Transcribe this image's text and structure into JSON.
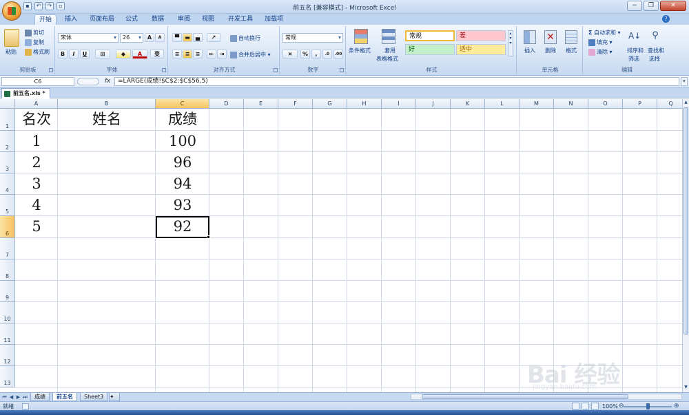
{
  "window": {
    "title": "前五名 [兼容模式] - Microsoft Excel",
    "minimize_label": "−",
    "restore_label": "❐",
    "close_label": "✕"
  },
  "ribbon_tabs": [
    "开始",
    "插入",
    "页面布局",
    "公式",
    "数据",
    "审阅",
    "视图",
    "开发工具",
    "加载项"
  ],
  "ribbon_tabs_active": 0,
  "clipboard": {
    "paste": "粘贴",
    "cut": "剪切",
    "copy": "复制",
    "format_painter": "格式刷",
    "label": "剪贴板"
  },
  "font": {
    "name": "宋体",
    "size": "26",
    "bold": "B",
    "italic": "I",
    "underline": "U",
    "label": "字体",
    "grow": "A",
    "shrink": "A",
    "font_color": "A",
    "phonetic": "变"
  },
  "alignment": {
    "wrap": "自动换行",
    "merge": "合并后居中",
    "label": "对齐方式"
  },
  "number": {
    "format": "常规",
    "percent": "%",
    "comma": ",",
    "label": "数字",
    "inc_decimal": ".0",
    "dec_decimal": ".00"
  },
  "styles": {
    "conditional": "条件格式",
    "table_format_1": "套用",
    "table_format_2": "表格格式",
    "normal": "常规",
    "bad": "差",
    "good": "好",
    "neutral": "适中",
    "label": "样式"
  },
  "cells_group": {
    "insert": "插入",
    "delete": "删除",
    "format": "格式",
    "label": "单元格"
  },
  "editing": {
    "autosum": "自动求和",
    "fill": "填充",
    "clear": "清除",
    "sort_1": "排序和",
    "sort_2": "筛选",
    "find_1": "查找和",
    "find_2": "选择",
    "label": "编辑"
  },
  "formula_bar": {
    "name_box": "C6",
    "fx": "fx",
    "formula": "=LARGE(成绩!$C$2:$C$56,5)"
  },
  "document_tab": "前五名.xls *",
  "columns": [
    "A",
    "B",
    "C",
    "D",
    "E",
    "F",
    "G",
    "H",
    "I",
    "J",
    "K",
    "L",
    "M",
    "N",
    "O",
    "P",
    "Q"
  ],
  "rows": [
    "1",
    "2",
    "3",
    "4",
    "5",
    "6",
    "7",
    "8",
    "9",
    "10",
    "11",
    "12",
    "13"
  ],
  "selected_cell": "C6",
  "cells": {
    "A1": "名次",
    "B1": "姓名",
    "C1": "成绩",
    "A2": "1",
    "C2": "100",
    "A3": "2",
    "C3": "96",
    "A4": "3",
    "C4": "94",
    "A5": "4",
    "C5": "93",
    "A6": "5",
    "C6": "92"
  },
  "sheet_tabs": [
    "成绩",
    "前五名",
    "Sheet3"
  ],
  "sheet_tabs_active": 1,
  "status": {
    "ready": "就绪",
    "zoom": "100%"
  },
  "watermark": {
    "text": "Bai 经验",
    "url": "jingyan.baidu.com"
  }
}
